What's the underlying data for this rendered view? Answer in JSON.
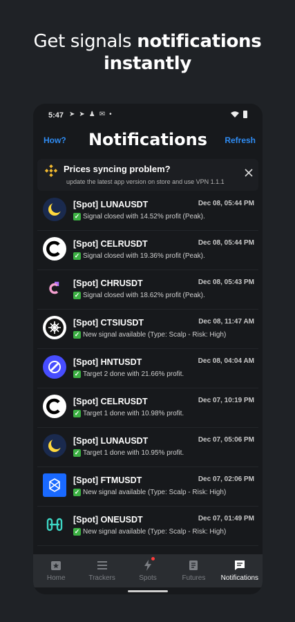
{
  "promo": {
    "line1_normal": "Get signals ",
    "line1_bold": "notifications",
    "line2_bold": "instantly"
  },
  "status": {
    "time": "5:47",
    "icons": [
      "telegram-icon",
      "telegram-icon",
      "person-icon",
      "gmail-icon",
      "dot-icon"
    ]
  },
  "header": {
    "how": "How?",
    "title": "Notifications",
    "refresh": "Refresh"
  },
  "banner": {
    "title": "Prices syncing problem?",
    "subtitle": "update the latest app version on store and use VPN 1.1.1",
    "logo": "binance-icon"
  },
  "notifications": [
    {
      "pair": "[Spot] LUNAUSDT",
      "time": "Dec 08, 05:44 PM",
      "message": "Signal closed with 14.52% profit (Peak).",
      "logo": "luna-logo"
    },
    {
      "pair": "[Spot] CELRUSDT",
      "time": "Dec 08, 05:44 PM",
      "message": "Signal closed with 19.36% profit (Peak).",
      "logo": "celr-logo"
    },
    {
      "pair": "[Spot] CHRUSDT",
      "time": "Dec 08, 05:43 PM",
      "message": "Signal closed with 18.62% profit (Peak).",
      "logo": "chr-logo"
    },
    {
      "pair": "[Spot] CTSIUSDT",
      "time": "Dec 08, 11:47 AM",
      "message": "New signal available (Type: Scalp - Risk: High)",
      "logo": "ctsi-logo"
    },
    {
      "pair": "[Spot] HNTUSDT",
      "time": "Dec 08, 04:04 AM",
      "message": "Target 2 done with 21.66% profit.",
      "logo": "hnt-logo"
    },
    {
      "pair": "[Spot] CELRUSDT",
      "time": "Dec 07, 10:19 PM",
      "message": "Target 1 done with 10.98% profit.",
      "logo": "celr-logo"
    },
    {
      "pair": "[Spot] LUNAUSDT",
      "time": "Dec 07, 05:06 PM",
      "message": "Target 1 done with 10.95% profit.",
      "logo": "luna-logo"
    },
    {
      "pair": "[Spot] FTMUSDT",
      "time": "Dec 07, 02:06 PM",
      "message": "New signal available (Type: Scalp - Risk: High)",
      "logo": "ftm-logo"
    },
    {
      "pair": "[Spot] ONEUSDT",
      "time": "Dec 07, 01:49 PM",
      "message": "New signal available (Type: Scalp - Risk: High)",
      "logo": "one-logo"
    }
  ],
  "tabs": [
    {
      "label": "Home",
      "icon": "star-box-icon",
      "active": false
    },
    {
      "label": "Trackers",
      "icon": "list-icon",
      "active": false
    },
    {
      "label": "Spots",
      "icon": "lightning-icon",
      "active": false,
      "badge": true
    },
    {
      "label": "Futures",
      "icon": "scroll-icon",
      "active": false
    },
    {
      "label": "Notifications",
      "icon": "chat-icon",
      "active": true
    }
  ],
  "colors": {
    "accent": "#2f8cf3",
    "background": "#17191c",
    "check": "#3cb043",
    "badge": "#ff3b3b"
  }
}
